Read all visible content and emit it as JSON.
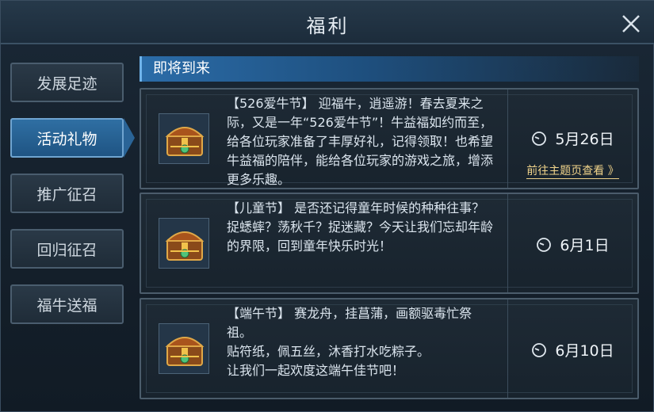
{
  "window": {
    "title": "福利"
  },
  "sidebar": {
    "items": [
      {
        "label": "发展足迹"
      },
      {
        "label": "活动礼物",
        "active": true
      },
      {
        "label": "推广征召"
      },
      {
        "label": "回归征召"
      },
      {
        "label": "福牛送福"
      }
    ]
  },
  "section": {
    "title": "即将到来"
  },
  "events": [
    {
      "text": "【526爱牛节】 迎福牛，逍遥游！春去夏来之际，又是一年“526爱牛节”！牛益福如约而至，给各位玩家准备了丰厚好礼，记得领取！也希望牛益福的陪伴，能给各位玩家的游戏之旅，增添更多乐趣。",
      "date": "5月26日",
      "link": "前往主题页查看 》"
    },
    {
      "text": "【儿童节】 是否还记得童年时候的种种往事？捉蟋蟀？荡秋千？捉迷藏？今天让我们忘却年龄的界限，回到童年快乐时光！",
      "date": "6月1日"
    },
    {
      "text": "【端午节】 赛龙舟，挂菖蒲，画额驱毒忙祭祖。\n 贴符纸，佩五丝，沐香打水吃粽子。\n 让我们一起欢度这端午佳节吧！",
      "date": "6月10日"
    }
  ],
  "colors": {
    "accent": "#2f6fa3",
    "link": "#f0d38a",
    "panel_border": "#4b5c6b"
  },
  "icons": {
    "close": "close-icon",
    "chest": "treasure-chest-icon",
    "clock": "clock-icon"
  }
}
